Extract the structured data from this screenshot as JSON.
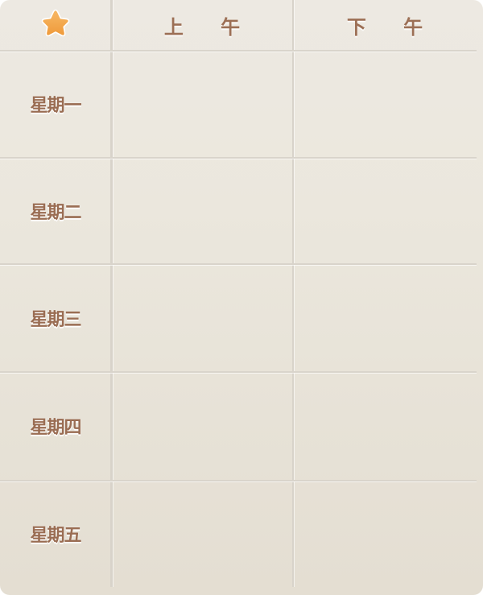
{
  "header": {
    "corner_icon": "star-icon",
    "columns": [
      "上 午",
      "下 午"
    ]
  },
  "days": [
    "星期一",
    "星期二",
    "星期三",
    "星期四",
    "星期五"
  ],
  "colors": {
    "star_fill": "#f3a54a",
    "star_edge": "#e38f2f",
    "label_text": "#9c6f55",
    "grid_line": "#d8d3ca"
  }
}
